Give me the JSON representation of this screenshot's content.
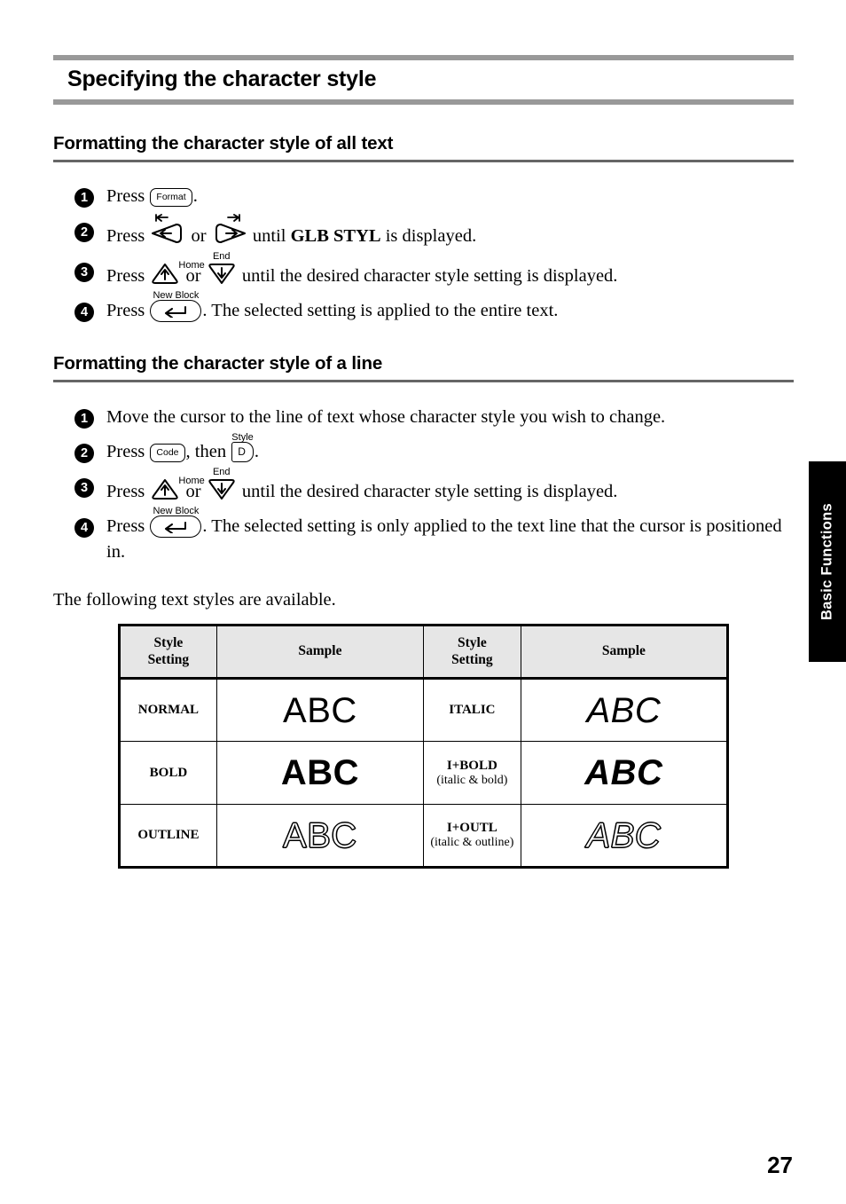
{
  "page": {
    "chapter_title": "Specifying the character style",
    "page_number": "27",
    "side_tab": "Basic Functions"
  },
  "sections": [
    {
      "heading": "Formatting the character style of all text",
      "steps": [
        {
          "number": "1",
          "parts": [
            {
              "type": "text",
              "value": "Press "
            },
            {
              "type": "key",
              "key_label": "Format",
              "key_style": "rect",
              "cap": ""
            },
            {
              "type": "text",
              "value": "."
            }
          ]
        },
        {
          "number": "2",
          "parts": [
            {
              "type": "text",
              "value": "Press "
            },
            {
              "type": "key",
              "key_label": "left-arrow",
              "key_style": "triangle-left",
              "cap": "tab-left"
            },
            {
              "type": "text",
              "value": " or "
            },
            {
              "type": "key",
              "key_label": "right-arrow",
              "key_style": "triangle-right",
              "cap": "tab-right"
            },
            {
              "type": "text",
              "value": " until "
            },
            {
              "type": "bold",
              "value": "GLB STYL"
            },
            {
              "type": "text",
              "value": " is displayed."
            }
          ]
        },
        {
          "number": "3",
          "parts": [
            {
              "type": "text",
              "value": "Press "
            },
            {
              "type": "key",
              "key_label": "up-arrow",
              "key_style": "triangle-up",
              "cap": "Home"
            },
            {
              "type": "text",
              "value": " or "
            },
            {
              "type": "key",
              "key_label": "down-arrow",
              "key_style": "triangle-down",
              "cap": "End"
            },
            {
              "type": "text",
              "value": " until the desired character style setting is displayed."
            }
          ]
        },
        {
          "number": "4",
          "parts": [
            {
              "type": "text",
              "value": "Press "
            },
            {
              "type": "key",
              "key_label": "return-arrow",
              "key_style": "enter",
              "cap": "New Block"
            },
            {
              "type": "text",
              "value": ". The selected setting is applied to the entire text."
            }
          ]
        }
      ]
    },
    {
      "heading": "Formatting the character style of a line",
      "steps": [
        {
          "number": "1",
          "parts": [
            {
              "type": "text",
              "value": "Move the cursor to the line of text whose character style you wish to change."
            }
          ]
        },
        {
          "number": "2",
          "parts": [
            {
              "type": "text",
              "value": "Press "
            },
            {
              "type": "key",
              "key_label": "Code",
              "key_style": "rect",
              "cap": ""
            },
            {
              "type": "text",
              "value": ", then "
            },
            {
              "type": "key",
              "key_label": "D",
              "key_style": "dkey",
              "cap": "Style"
            },
            {
              "type": "text",
              "value": "."
            }
          ]
        },
        {
          "number": "3",
          "parts": [
            {
              "type": "text",
              "value": "Press "
            },
            {
              "type": "key",
              "key_label": "up-arrow",
              "key_style": "triangle-up",
              "cap": "Home"
            },
            {
              "type": "text",
              "value": " or "
            },
            {
              "type": "key",
              "key_label": "down-arrow",
              "key_style": "triangle-down",
              "cap": "End"
            },
            {
              "type": "text",
              "value": " until the desired character style setting is displayed."
            }
          ]
        },
        {
          "number": "4",
          "parts": [
            {
              "type": "text",
              "value": "Press "
            },
            {
              "type": "key",
              "key_label": "return-arrow",
              "key_style": "enter",
              "cap": "New Block"
            },
            {
              "type": "text",
              "value": ". The selected setting is only applied to the text line that the cursor is positioned in."
            }
          ]
        }
      ]
    }
  ],
  "intro_line": "The following text styles are available.",
  "style_table": {
    "headers": [
      "Style Setting",
      "Sample",
      "Style Setting",
      "Sample"
    ],
    "header_line1": "Style",
    "header_line2": "Setting",
    "header_sample": "Sample",
    "rows": [
      {
        "left_setting": "NORMAL",
        "left_setting_sub": "",
        "left_sample": "ABC",
        "left_sample_style": "normal",
        "right_setting": "ITALIC",
        "right_setting_sub": "",
        "right_sample": "ABC",
        "right_sample_style": "italic"
      },
      {
        "left_setting": "BOLD",
        "left_setting_sub": "",
        "left_sample": "ABC",
        "left_sample_style": "bold",
        "right_setting": "I+BOLD",
        "right_setting_sub": "(italic & bold)",
        "right_sample": "ABC",
        "right_sample_style": "italic-bold"
      },
      {
        "left_setting": "OUTLINE",
        "left_setting_sub": "",
        "left_sample": "ABC",
        "left_sample_style": "outline",
        "right_setting": "I+OUTL",
        "right_setting_sub": "(italic & outline)",
        "right_sample": "ABC",
        "right_sample_style": "italic-outline"
      }
    ]
  },
  "colors": {
    "title_rule": "#999999",
    "section_rule": "#666666",
    "table_header_bg": "#e6e6e6",
    "side_tab_bg": "#000000"
  }
}
